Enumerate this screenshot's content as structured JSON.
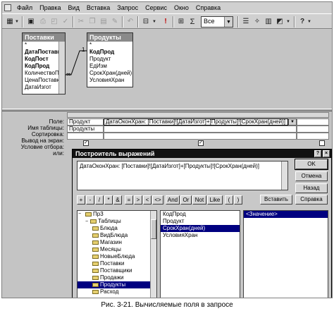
{
  "menu": [
    "Файл",
    "Правка",
    "Вид",
    "Вставка",
    "Запрос",
    "Сервис",
    "Окно",
    "Справка"
  ],
  "toolbar": {
    "top_values_combo": "Все"
  },
  "tables": {
    "postavki": {
      "title": "Поставки",
      "fields": [
        {
          "name": "*",
          "key": false
        },
        {
          "name": "ДатаПоставки",
          "key": true
        },
        {
          "name": "КодПост",
          "key": true
        },
        {
          "name": "КодПрод",
          "key": true
        },
        {
          "name": "КоличествоП",
          "key": false
        },
        {
          "name": "ЦенаПоставки",
          "key": false
        },
        {
          "name": "ДатаИзгот",
          "key": false
        }
      ]
    },
    "produkty": {
      "title": "Продукты",
      "fields": [
        {
          "name": "*",
          "key": false
        },
        {
          "name": "КодПрод",
          "key": true
        },
        {
          "name": "Продукт",
          "key": false
        },
        {
          "name": "ЕдИзм",
          "key": false
        },
        {
          "name": "СрокХран(дней)",
          "key": false
        },
        {
          "name": "УсловияХран",
          "key": false
        }
      ]
    },
    "relation": {
      "one": "1",
      "many": "∞"
    }
  },
  "design_grid": {
    "row_labels": [
      "Поле:",
      "Имя таблицы:",
      "Сортировка:",
      "Вывод на экран:",
      "Условие отбора:",
      "или:"
    ],
    "columns": [
      {
        "field": "Продукт",
        "table": "Продукты",
        "show": true
      },
      {
        "field": "ДатаОконХран: [Поставки]![ДатаИзгот]+[Продукты]![СрокХран(дней)]",
        "table": "",
        "show": true
      }
    ]
  },
  "dialog": {
    "title": "Построитель выражений",
    "expression": "ДатаОконХран: [Поставки]![ДатаИзгот]+[Продукты]![СрокХран(дней)]",
    "buttons": {
      "ok": "OK",
      "cancel": "Отмена",
      "back": "Назад",
      "insert": "Вставить",
      "help": "Справка"
    },
    "operators": [
      "+",
      "-",
      "/",
      "*",
      "&",
      "=",
      ">",
      "<",
      "<>",
      "And",
      "Or",
      "Not",
      "Like",
      "(",
      ")"
    ],
    "folders": [
      {
        "label": "Пр3",
        "indent": 0,
        "expanded": true,
        "selected": false
      },
      {
        "label": "Таблицы",
        "indent": 1,
        "expanded": true,
        "selected": false
      },
      {
        "label": "Блюда",
        "indent": 2,
        "selected": false
      },
      {
        "label": "ВидБлюда",
        "indent": 2,
        "selected": false
      },
      {
        "label": "Магазин",
        "indent": 2,
        "selected": false
      },
      {
        "label": "Месяцы",
        "indent": 2,
        "selected": false
      },
      {
        "label": "НовыеБлюда",
        "indent": 2,
        "selected": false
      },
      {
        "label": "Поставки",
        "indent": 2,
        "selected": false
      },
      {
        "label": "Поставщики",
        "indent": 2,
        "selected": false
      },
      {
        "label": "Продажи",
        "indent": 2,
        "selected": false
      },
      {
        "label": "Продукты",
        "indent": 2,
        "selected": true
      },
      {
        "label": "Расход",
        "indent": 2,
        "selected": false
      }
    ],
    "fields_list": [
      {
        "label": "КодПрод",
        "selected": false
      },
      {
        "label": "Продукт",
        "selected": false
      },
      {
        "label": "СрокХран(дней)",
        "selected": true
      },
      {
        "label": "УсловияХран",
        "selected": false
      }
    ],
    "values_list": [
      {
        "label": "<Значение>",
        "selected": true
      }
    ]
  },
  "caption": "Рис. 3-21. Вычисляемые поля в запросе"
}
